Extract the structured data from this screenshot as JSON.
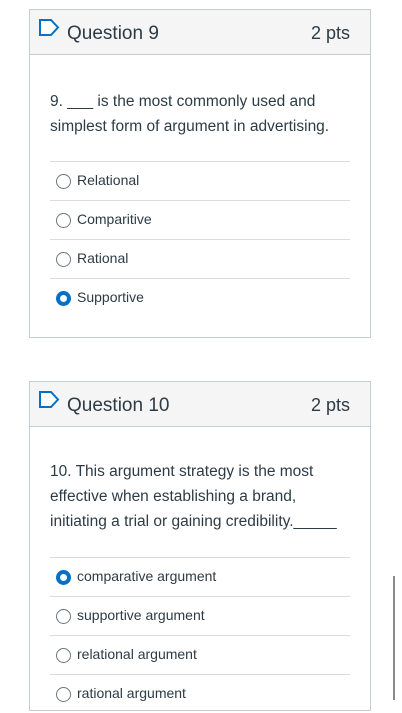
{
  "questions": [
    {
      "title": "Question 9",
      "points": "2 pts",
      "text": "9. ___ is the most commonly used and simplest form of argument in advertising.",
      "answers": [
        {
          "label": "Relational",
          "selected": false
        },
        {
          "label": "Comparitive",
          "selected": false
        },
        {
          "label": "Rational",
          "selected": false
        },
        {
          "label": "Supportive",
          "selected": true
        }
      ]
    },
    {
      "title": "Question 10",
      "points": "2 pts",
      "text": "10. This argument strategy is the most effective when establishing a brand, initiating a trial or gaining credibility._____",
      "answers": [
        {
          "label": "comparative argument",
          "selected": true
        },
        {
          "label": "supportive argument",
          "selected": false
        },
        {
          "label": "relational argument",
          "selected": false
        },
        {
          "label": "rational argument",
          "selected": false
        }
      ]
    }
  ],
  "colors": {
    "accent": "#0770c4",
    "header_bg": "#f5f5f5",
    "border": "#c7cdd1",
    "text": "#2d3b45"
  },
  "icons": {
    "flag": "flag-icon",
    "radio": "radio-button"
  }
}
